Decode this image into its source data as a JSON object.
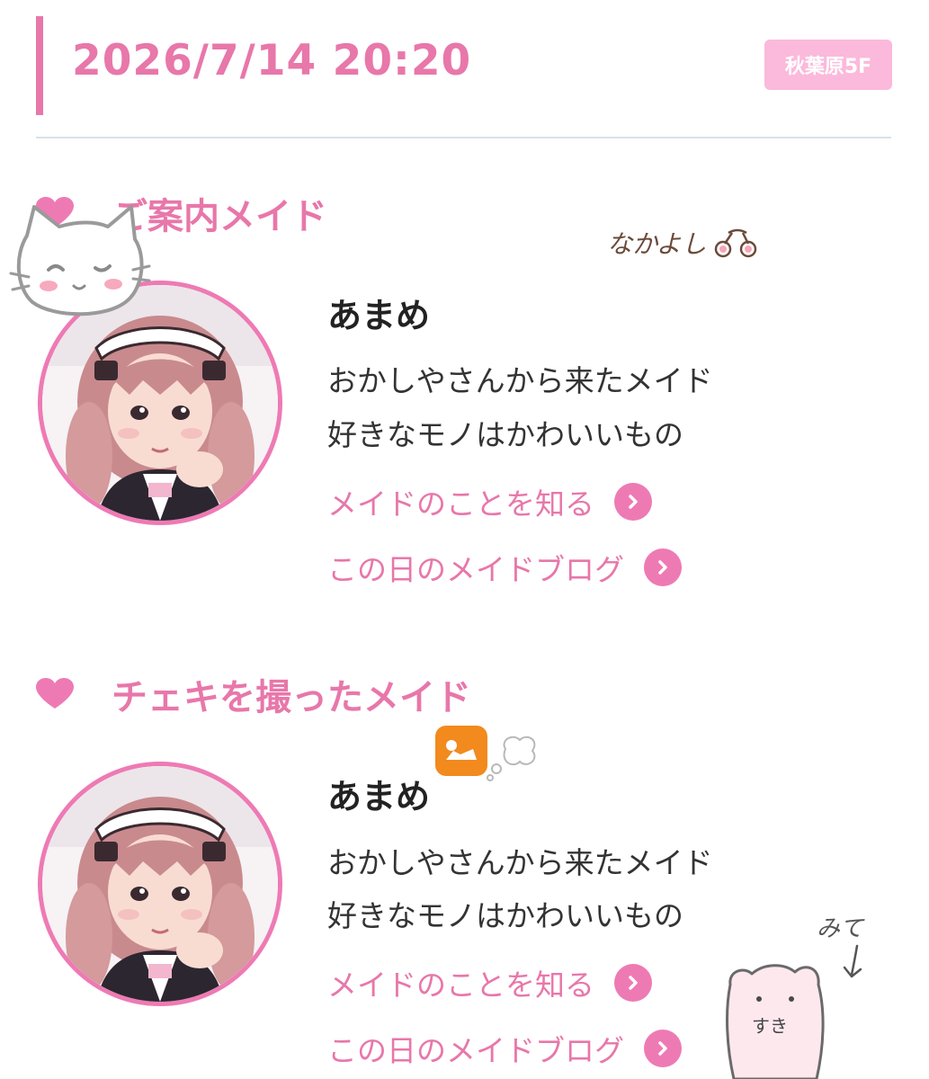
{
  "header": {
    "datetime": "2026/7/14 20:20",
    "store_badge": "秋葉原5F"
  },
  "sections": [
    {
      "title": "ご案内メイド",
      "maid": {
        "name": "あまめ",
        "bio_line1": "おかしやさんから来たメイド",
        "bio_line2": "好きなモノはかわいいもの",
        "link_profile": "メイドのことを知る",
        "link_blog": "この日のメイドブログ"
      }
    },
    {
      "title": "チェキを撮ったメイド",
      "maid": {
        "name": "あまめ",
        "bio_line1": "おかしやさんから来たメイド",
        "bio_line2": "好きなモノはかわいいもの",
        "link_profile": "メイドのことを知る",
        "link_blog": "この日のメイドブログ"
      }
    }
  ],
  "stickers": {
    "nakayoshi": "なかよし",
    "mite": "みて",
    "suki": "すき"
  },
  "colors": {
    "accent": "#e877aa",
    "badge_bg": "#fbb9db",
    "divider": "#d9e1ec"
  }
}
